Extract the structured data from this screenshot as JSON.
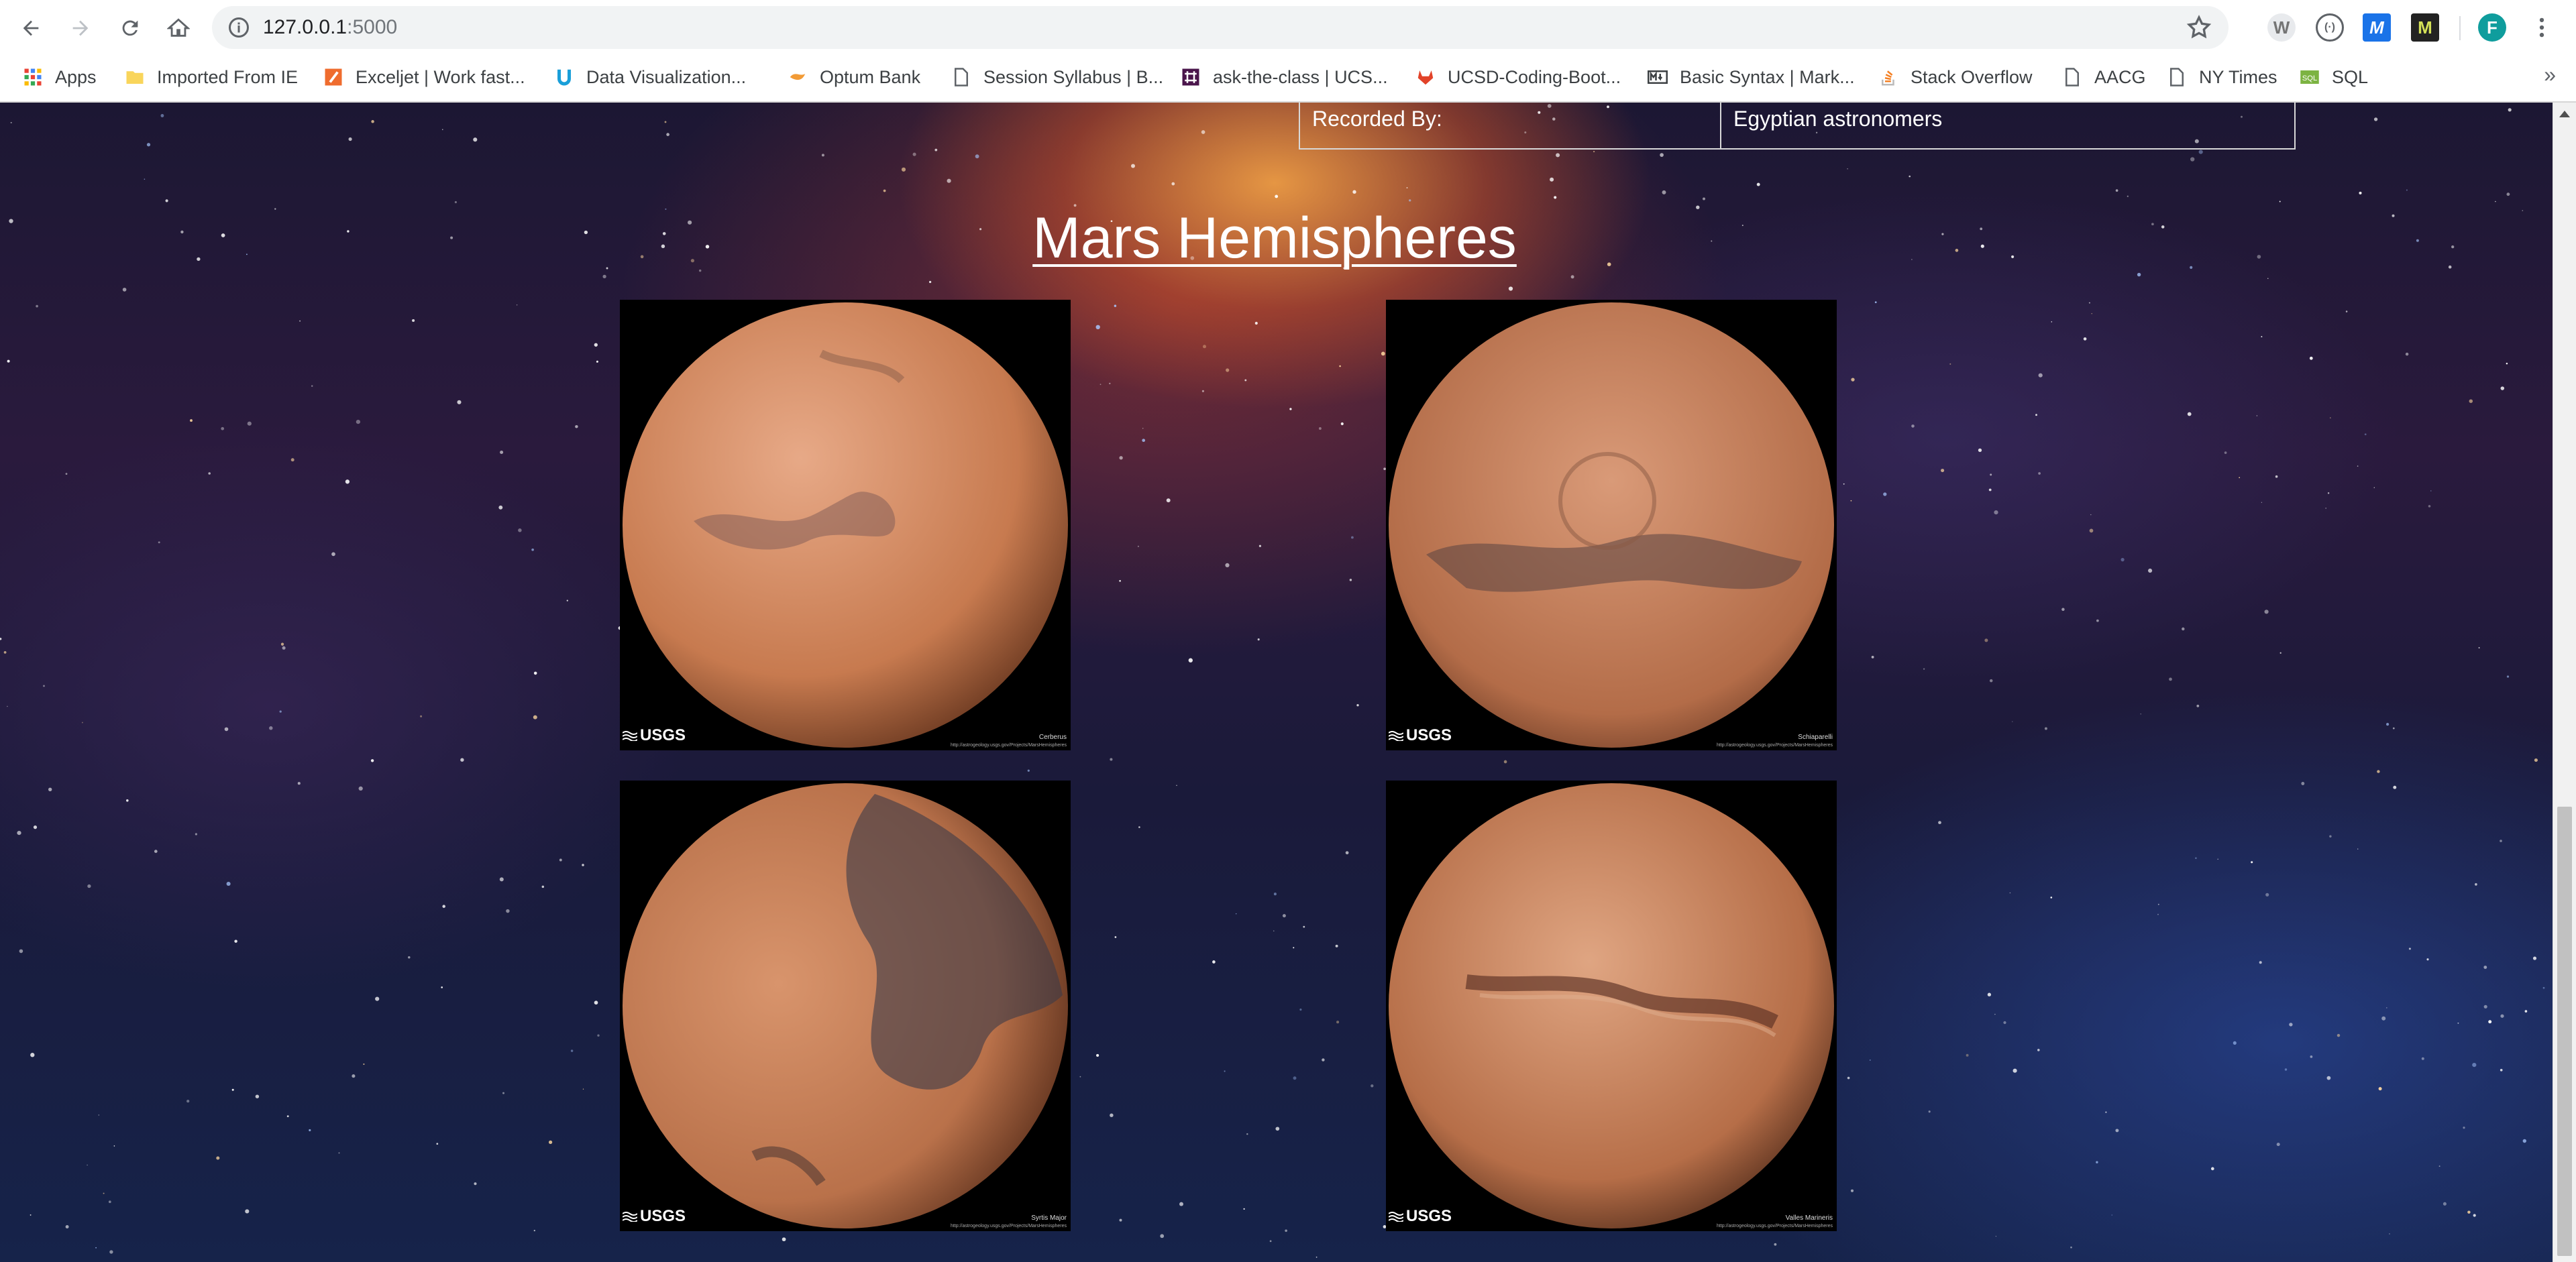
{
  "browser": {
    "url_host": "127.0.0.1",
    "url_port": ":5000",
    "profile_initial": "F",
    "extensions": [
      {
        "label": "W",
        "color": "#9e9e9e"
      },
      {
        "label": "(·)",
        "color": "#5f6368"
      },
      {
        "label": "M",
        "color": "#1a73e8"
      },
      {
        "label": "M",
        "color": "#c6d02a"
      }
    ],
    "bookmarks": [
      {
        "label": "Apps",
        "icon": "apps-grid-icon"
      },
      {
        "label": "Imported From IE",
        "icon": "folder-icon"
      },
      {
        "label": "Exceljet | Work fast...",
        "icon": "exceljet-icon"
      },
      {
        "label": "Data Visualization...",
        "icon": "ucsd-icon"
      },
      {
        "label": "Optum Bank",
        "icon": "optum-icon"
      },
      {
        "label": "Session Syllabus | B...",
        "icon": "page-icon"
      },
      {
        "label": "ask-the-class | UCS...",
        "icon": "slack-icon"
      },
      {
        "label": "UCSD-Coding-Boot...",
        "icon": "gitlab-icon"
      },
      {
        "label": "Basic Syntax | Mark...",
        "icon": "markdown-icon"
      },
      {
        "label": "Stack Overflow",
        "icon": "stackoverflow-icon"
      },
      {
        "label": "AACG",
        "icon": "page-icon"
      },
      {
        "label": "NY Times",
        "icon": "page-icon"
      },
      {
        "label": "SQL",
        "icon": "sql-icon"
      }
    ],
    "more_bookmarks": "»"
  },
  "facts": {
    "label": "Recorded By:",
    "value": "Egyptian astronomers"
  },
  "hemispheres": {
    "title": "Mars Hemispheres",
    "items": [
      {
        "caption": "Cerberus",
        "logo": "USGS",
        "url": "http://astrogeology.usgs.gov/Projects/MarsHemispheres"
      },
      {
        "caption": "Schiaparelli",
        "logo": "USGS",
        "url": "http://astrogeology.usgs.gov/Projects/MarsHemispheres"
      },
      {
        "caption": "Syrtis Major",
        "logo": "USGS",
        "url": "http://astrogeology.usgs.gov/Projects/MarsHemispheres"
      },
      {
        "caption": "Valles Marineris",
        "logo": "USGS",
        "url": "http://astrogeology.usgs.gov/Projects/MarsHemispheres"
      }
    ]
  },
  "colors": {
    "mars_light": "#e0a07a",
    "mars_mid": "#c47a4f",
    "mars_dark": "#5c3a2e",
    "accent_profile": "#0f9d9d"
  }
}
